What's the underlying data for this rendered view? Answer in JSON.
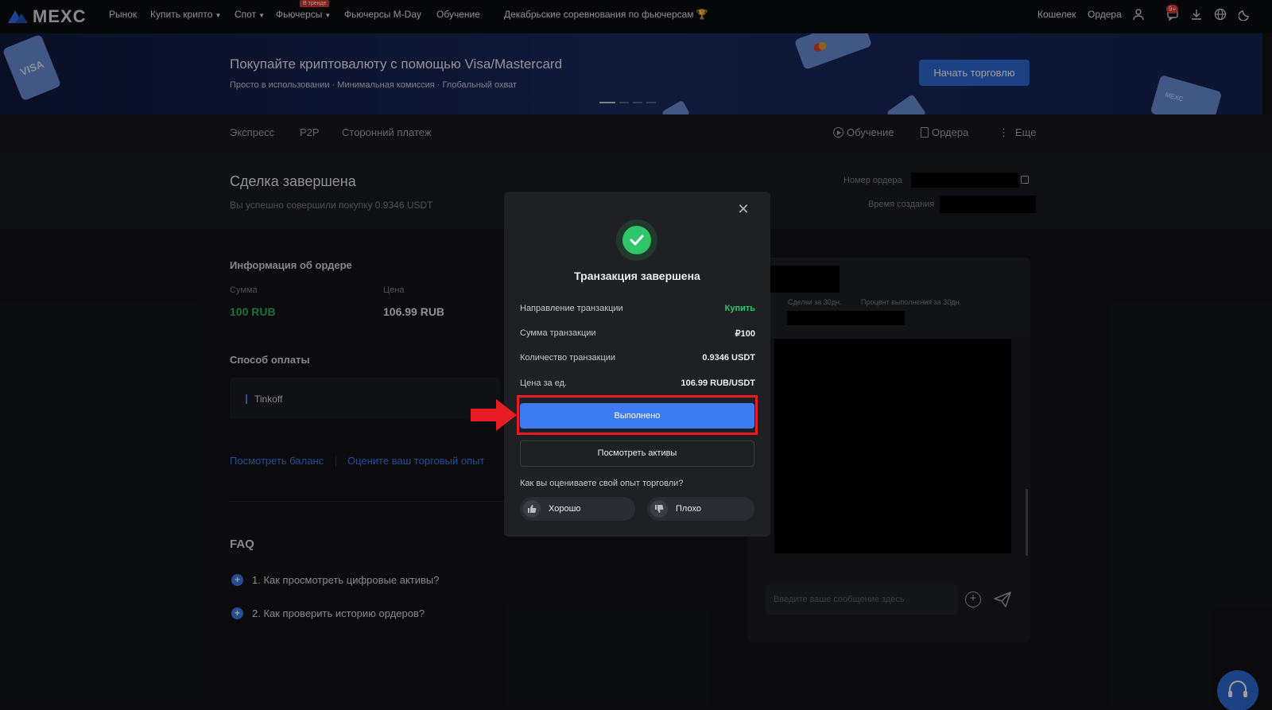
{
  "nav": {
    "logo": "MEXC",
    "items": [
      "Рынок",
      "Купить крипто",
      "Спот",
      "Фьючерсы",
      "Фьючерсы M-Day",
      "Обучение",
      "Декабрьские соревнования по фьючерсам"
    ],
    "hot_badge": "В тренде",
    "wallet": "Кошелек",
    "orders": "Ордера",
    "notif_count": "9+"
  },
  "banner": {
    "title": "Покупайте криптовалюту с помощью Visa/Mastercard",
    "subtitle": "Просто в использовании · Минимальная комиссия · Глобальный охват",
    "button": "Начать торговлю",
    "card_visa": "VISA",
    "card_mexc": "MEXC"
  },
  "subnav": {
    "items": [
      "Экспресс",
      "P2P",
      "Сторонний платеж"
    ],
    "learn": "Обучение",
    "orders": "Ордера",
    "more": "Еще"
  },
  "deal": {
    "title": "Сделка завершена",
    "subtitle": "Вы успешно совершили покупку 0.9346 USDT",
    "order_number_label": "Номер ордера",
    "created_label": "Время создания"
  },
  "order_info": {
    "title": "Информация об ордере",
    "sum_label": "Сумма",
    "sum_value": "100 RUB",
    "price_label": "Цена",
    "price_value": "106.99 RUB"
  },
  "payment": {
    "title": "Способ оплаты",
    "method": "Tinkoff"
  },
  "links": {
    "view_balance": "Посмотреть баланс",
    "rate_experience": "Оцените ваш торговый опыт"
  },
  "faq": {
    "title": "FAQ",
    "items": [
      "1. Как просмотреть цифровые активы?",
      "2. Как проверить историю ордеров?"
    ]
  },
  "chat": {
    "deals_30d": "Сделки за 30дн.",
    "completion_30d": "Процент выполнения за 30дн.",
    "input_placeholder": "Введите ваше сообщение здесь"
  },
  "modal": {
    "title": "Транзакция завершена",
    "rows": [
      {
        "label": "Направление транзакции",
        "value": "Купить"
      },
      {
        "label": "Сумма транзакции",
        "value": "₽100"
      },
      {
        "label": "Количество транзакции",
        "value": "0.9346 USDT"
      },
      {
        "label": "Цена за ед.",
        "value": "106.99 RUB/USDT"
      }
    ],
    "done_button": "Выполнено",
    "assets_button": "Посмотреть активы",
    "rate_question": "Как вы оцениваете свой опыт торговли?",
    "good": "Хорошо",
    "bad": "Плохо"
  },
  "colors": {
    "accent": "#3d7cf0",
    "success": "#2fc56b",
    "highlight": "#e81c24"
  }
}
